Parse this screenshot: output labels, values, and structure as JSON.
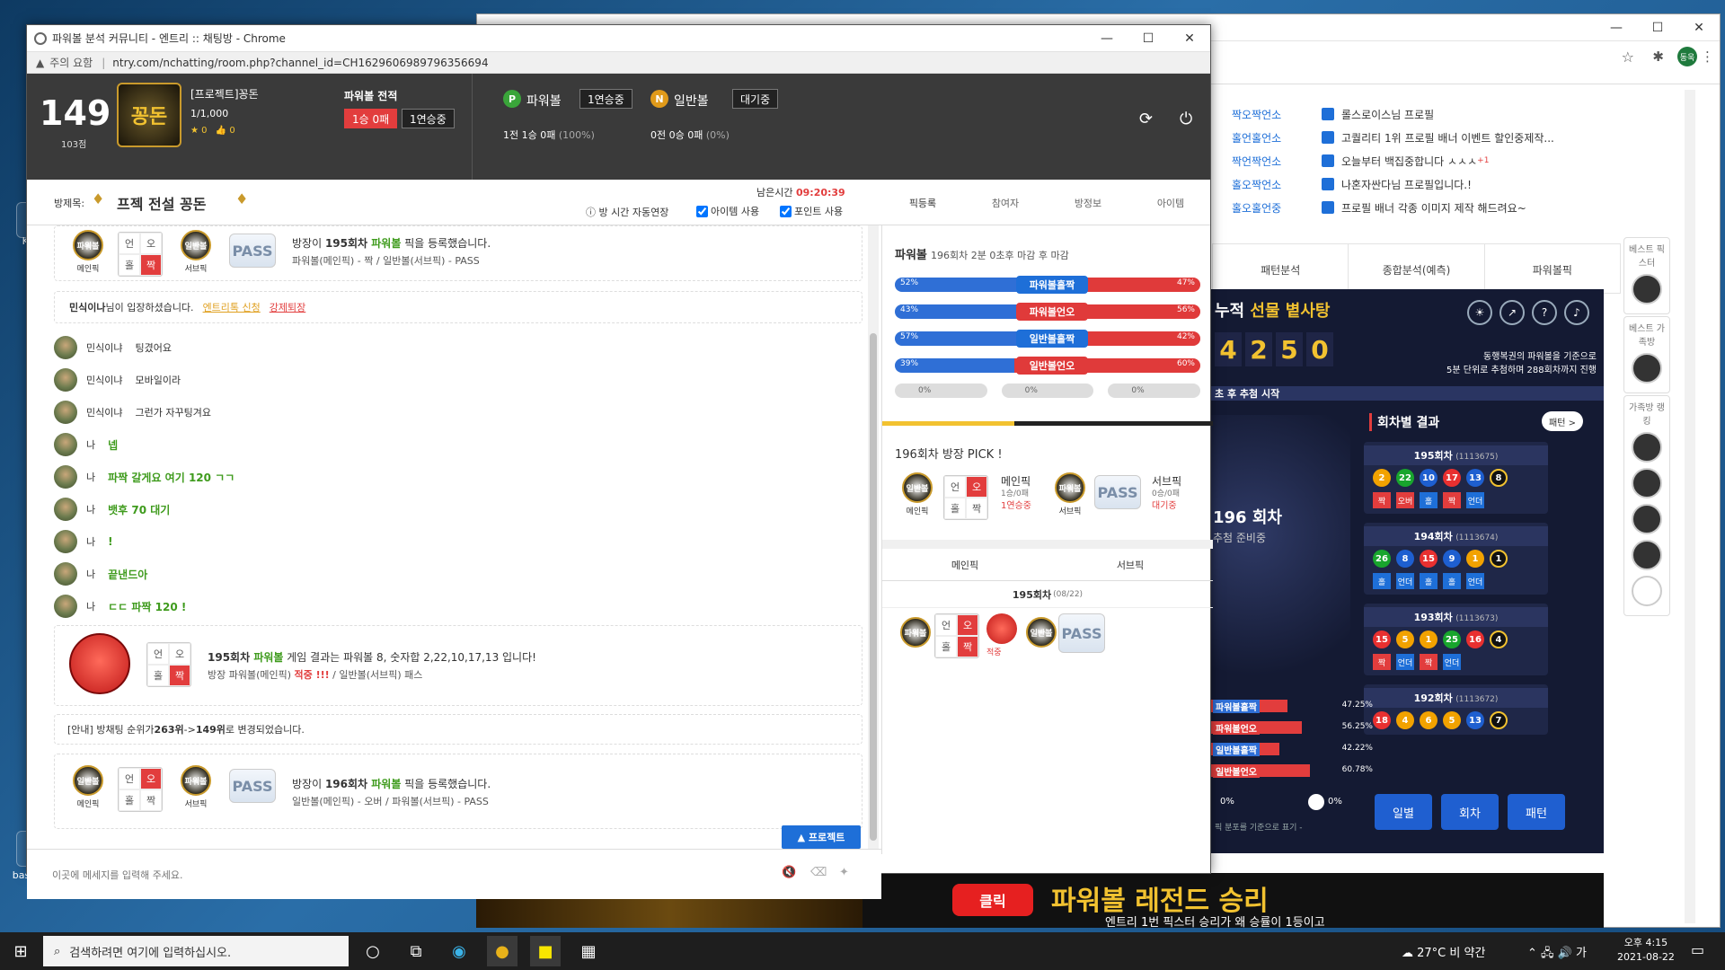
{
  "desktop": {
    "icons": [
      "Kaka",
      "basic-vs"
    ]
  },
  "bg_browser": {
    "profile": "동욱",
    "score_links": [
      "짝오짝언소",
      "홀언홀언소",
      "짝언짝언소",
      "홀오짝언소",
      "홀오홀언중"
    ],
    "notices": [
      "롤스로이스님 프로필",
      "고퀄리티 1위 프로필 배너 이벤트 할인중제작...",
      "오늘부터 백집중합니다 ㅅㅅㅅ",
      "나혼자싼다님 프로필입니다.!",
      "프로필 배너 각종 이미지 제작 해드려요~"
    ],
    "notice_plus": "+1",
    "tabs": [
      "패턴분석",
      "종합분석(예측)",
      "파워볼픽"
    ],
    "side": {
      "best_picks": "베스트 픽스터",
      "best_family": "베스트 가족방",
      "family_rank": "가족방 랭킹"
    },
    "lotto": {
      "title_prefix": "누적 ",
      "title_highlight": "선물 볕사탕",
      "digits": [
        "4",
        "2",
        "5",
        "0"
      ],
      "desc1": "동행복권의 파워볼을 기준으로",
      "desc2": "5분 단위로 추첨하며 288회차까지 진행",
      "strip": "초 후 추첨 시작",
      "machine_round": "196 회차",
      "machine_status": "추첨 준비중",
      "results_title": "회차별 결과",
      "pattern_btn": "패턴 >",
      "results": [
        {
          "round": "195회차",
          "id": "(1113675)",
          "balls": [
            "2",
            "22",
            "10",
            "17",
            "13"
          ],
          "power": "8",
          "colors": [
            "#f2a200",
            "#18a52d",
            "#1e5fd0",
            "#e83030",
            "#1e5fd0"
          ],
          "tags": [
            "짝",
            "오버",
            "홀",
            "짝",
            "언더"
          ]
        },
        {
          "round": "194회차",
          "id": "(1113674)",
          "balls": [
            "26",
            "8",
            "15",
            "9",
            "1"
          ],
          "power": "1",
          "colors": [
            "#18a52d",
            "#1e5fd0",
            "#e83030",
            "#1e5fd0",
            "#f2a200"
          ],
          "tags": [
            "홀",
            "언더",
            "홀",
            "홀",
            "언더"
          ]
        },
        {
          "round": "193회차",
          "id": "(1113673)",
          "balls": [
            "15",
            "5",
            "1",
            "25",
            "16"
          ],
          "power": "4",
          "colors": [
            "#e83030",
            "#f2a200",
            "#f2a200",
            "#18a52d",
            "#e83030"
          ],
          "tags": [
            "짝",
            "언더",
            "짝",
            "언더"
          ]
        },
        {
          "round": "192회차",
          "id": "(1113672)",
          "balls": [
            "18",
            "4",
            "6",
            "5",
            "13"
          ],
          "power": "7",
          "colors": [
            "#e83030",
            "#f2a200",
            "#f2a200",
            "#f2a200",
            "#1e5fd0"
          ],
          "tags": []
        }
      ],
      "pct_labels": [
        "파워볼홀짝",
        "파워볼언오",
        "일반볼홀짝",
        "일반볼언오"
      ],
      "pct_values": [
        "47.25%",
        "56.25%",
        "42.22%",
        "60.78%"
      ],
      "pct_fill": [
        0.47,
        0.56,
        0.42,
        0.61
      ],
      "zero1": "0%",
      "zero2": "0%",
      "foot_note": "픽 분포를 기준으로 표기 -",
      "buttons": [
        "일별",
        "회차",
        "패턴"
      ]
    },
    "banner": {
      "click": "클릭",
      "main": "파워볼 레전드 승리",
      "sub": "엔트리 1번 픽스터 승리가 왜 승률이 1등이고"
    }
  },
  "popup": {
    "title": "파워볼 분석 커뮤니티 - 엔트리 :: 채팅방 - Chrome",
    "warn": "주의 요함",
    "url": "ntry.com/nchatting/room.php?channel_id=CH1629606989796356694",
    "header": {
      "rank": "149",
      "points": "103점",
      "logo_text": "꽁돈",
      "name": "[프로젝트]꽁돈",
      "members": "1/1,000",
      "stars": "0",
      "likes": "0",
      "record_title": "파워볼 전적",
      "rec_red": "1승 0패",
      "rec_dark": "1연승중",
      "pw_letter": "P",
      "pw_label": "파워볼",
      "pw_state": "1연승중",
      "pw_stat": "1전 1승 0패",
      "pw_pct": "(100%)",
      "nb_letter": "N",
      "nb_label": "일반볼",
      "nb_state": "대기중",
      "nb_stat": "0전 0승 0패",
      "nb_pct": "(0%)"
    },
    "room": {
      "label": "방제목:",
      "title": "프젝 전설 꽁돈",
      "remain_label": "남은시간",
      "remain": "09:20:39",
      "auto_extend": "방 시간 자동연장",
      "item_use": "아이템 사용",
      "point_use": "포인트 사용",
      "tabs": [
        "픽등록",
        "참여자",
        "방정보",
        "아이템"
      ]
    },
    "chat": {
      "card1_text1": "방장이 ",
      "card1_round": "195회차",
      "card1_game": " 파워볼",
      "card1_text2": " 픽을 등록했습니다.",
      "card1_line2": "파워볼(메인픽) - 짝 / 일반볼(서브픽) - PASS",
      "main_label": "메인픽",
      "sub_label": "서브픽",
      "pass": "PASS",
      "badge_pw": "파워볼",
      "badge_nb": "일반볼",
      "grid": [
        "언",
        "오",
        "홀",
        "짝"
      ],
      "enter_name": "민식이나",
      "enter_text": "님이 입장하셨습니다.",
      "enter_btn1": "엔트리톡 신청",
      "enter_btn2": "강제퇴장",
      "messages": [
        {
          "user": "민식이냐",
          "text": "팅겼어요",
          "mine": false
        },
        {
          "user": "민식이냐",
          "text": "모바일이라",
          "mine": false
        },
        {
          "user": "민식이냐",
          "text": "그런가 자꾸팅겨요",
          "mine": false
        },
        {
          "user": "나",
          "text": "넵",
          "mine": true
        },
        {
          "user": "나",
          "text": "파짝 갈게요 여기 120 ㄱㄱ",
          "mine": true
        },
        {
          "user": "나",
          "text": "뱃후 70 대기",
          "mine": true
        },
        {
          "user": "나",
          "text": "!",
          "mine": true
        },
        {
          "user": "나",
          "text": "끝낸드아",
          "mine": true
        },
        {
          "user": "나",
          "text": "ㄷㄷ 파짝 120 !",
          "mine": true
        }
      ],
      "result_round": "195회차",
      "result_game": " 파워볼",
      "result_text": " 게임 결과는 파워볼 8, 숫자합 2,22,10,17,13 입니다!",
      "result_line2a": "방장 파워볼(메인픽) ",
      "result_hit": "적중 !!!",
      "result_line2b": " / 일반볼(서브픽) 패스",
      "rank_notice": "[안내] 방채팅 순위가 ",
      "rank_from": "263위",
      "rank_arrow": " -> ",
      "rank_to": "149위",
      "rank_end": " 로 변경되었습니다.",
      "card3_round": "196회차",
      "card3_line2": "일반볼(메인픽) - 오버 / 파워볼(서브픽) - PASS",
      "project_btn": "▲ 프로젝트",
      "input_placeholder": "이곳에 메세지를 입력해 주세요."
    },
    "right": {
      "title": "파워볼",
      "subtitle": "196회차 2분 0초후 마감 후 마감",
      "bars": [
        {
          "label": "파워볼홀짝",
          "left": "52%",
          "right": "47%",
          "color": "#1e6fd8"
        },
        {
          "label": "파워볼언오",
          "left": "43%",
          "right": "56%",
          "color": "#e03a3a"
        },
        {
          "label": "일반볼홀짝",
          "left": "57%",
          "right": "42%",
          "color": "#1e6fd8"
        },
        {
          "label": "일반볼언오",
          "left": "39%",
          "right": "60%",
          "color": "#e03a3a"
        }
      ],
      "mini": [
        "0%",
        "0%",
        "0%"
      ],
      "pick_title": "196회차 방장 PICK !",
      "main_label": "메인픽",
      "main_stat": "1승/0패",
      "main_streak": "1연승중",
      "sub_label": "서브픽",
      "sub_stat": "0승/0패",
      "sub_streak": "대기중",
      "col_main": "메인픽",
      "col_sub": "서브픽",
      "hist_round": "195회차",
      "hist_date": "(08/22)",
      "hist_hit": "적중"
    }
  },
  "taskbar": {
    "search_placeholder": "검색하려면 여기에 입력하십시오.",
    "weather": "27°C 비 약간",
    "time": "오후 4:15",
    "date": "2021-08-22"
  },
  "colors": {
    "accent_red": "#e23d3d",
    "accent_blue": "#1e6fd8",
    "green_text": "#3f9b1d",
    "gold": "#f2c230"
  }
}
